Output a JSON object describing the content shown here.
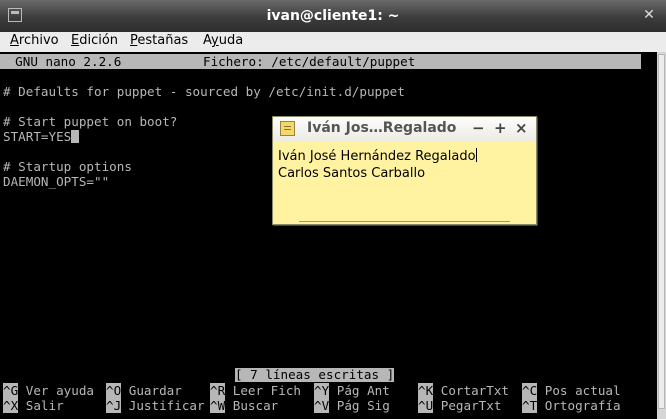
{
  "window": {
    "title": "ivan@cliente1: ~"
  },
  "menu": [
    "Archivo",
    "Edición",
    "Pestañas",
    "Ayuda"
  ],
  "menu_accel": [
    "A",
    "E",
    "P",
    "y"
  ],
  "nano": {
    "version": "  GNU nano 2.2.6",
    "file": "Fichero: /etc/default/puppet",
    "lines": [
      "# Defaults for puppet - sourced by /etc/init.d/puppet",
      "# Start puppet on boot?",
      "START=YES",
      "# Startup options",
      "DAEMON_OPTS=\"\""
    ],
    "status": "[ 7 líneas escritas ]",
    "shortcuts_row1": [
      {
        "key": "^G",
        "label": " Ver ayuda"
      },
      {
        "key": "^O",
        "label": " Guardar"
      },
      {
        "key": "^R",
        "label": " Leer Fich"
      },
      {
        "key": "^Y",
        "label": " Pág Ant"
      },
      {
        "key": "^K",
        "label": " CortarTxt"
      },
      {
        "key": "^C",
        "label": " Pos actual"
      }
    ],
    "shortcuts_row2": [
      {
        "key": "^X",
        "label": " Salir"
      },
      {
        "key": "^J",
        "label": " Justificar"
      },
      {
        "key": "^W",
        "label": " Buscar"
      },
      {
        "key": "^V",
        "label": " Pág Sig"
      },
      {
        "key": "^U",
        "label": " PegarTxt"
      },
      {
        "key": "^T",
        "label": " Ortografía"
      }
    ]
  },
  "note": {
    "title": "Iván Jos…Regalado",
    "lines": [
      "Iván José Hernández Regalado",
      "Carlos Santos Carballo"
    ],
    "buttons": [
      "−",
      "+",
      "×"
    ]
  }
}
